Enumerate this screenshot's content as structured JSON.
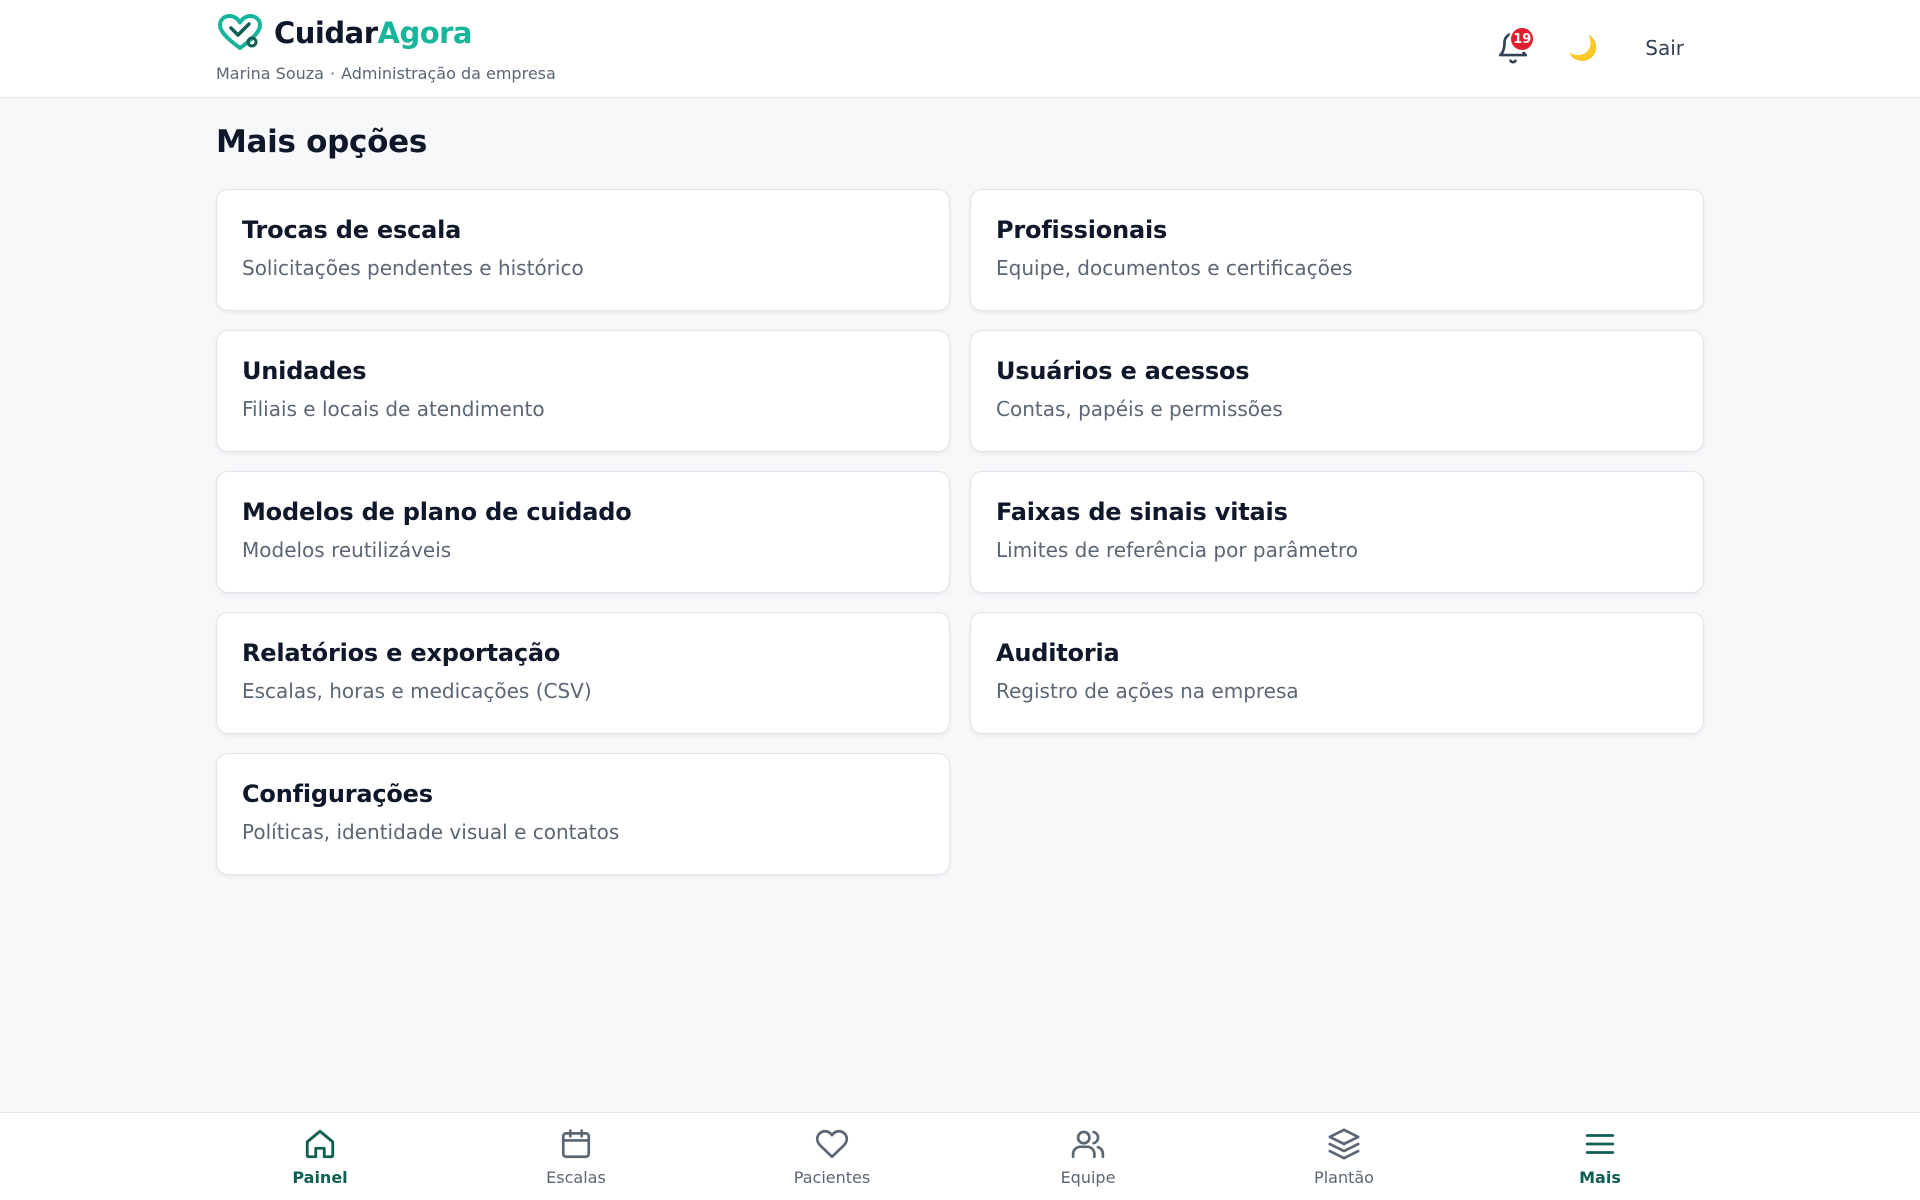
{
  "header": {
    "brand": {
      "name_part1": "Cuidar",
      "name_part2": "Agora"
    },
    "user_name": "Marina Souza",
    "separator": "·",
    "role": "Administração da empresa",
    "notifications": {
      "icon": "bell-icon",
      "count": "19"
    },
    "theme_toggle": {
      "icon": "moon-icon",
      "glyph": "🌙"
    },
    "logout_label": "Sair"
  },
  "main": {
    "title": "Mais opções",
    "cards": [
      {
        "title": "Trocas de escala",
        "description": "Solicitações pendentes e histórico"
      },
      {
        "title": "Profissionais",
        "description": "Equipe, documentos e certificações"
      },
      {
        "title": "Unidades",
        "description": "Filiais e locais de atendimento"
      },
      {
        "title": "Usuários e acessos",
        "description": "Contas, papéis e permissões"
      },
      {
        "title": "Modelos de plano de cuidado",
        "description": "Modelos reutilizáveis"
      },
      {
        "title": "Faixas de sinais vitais",
        "description": "Limites de referência por parâmetro"
      },
      {
        "title": "Relatórios e exportação",
        "description": "Escalas, horas e medicações (CSV)"
      },
      {
        "title": "Auditoria",
        "description": "Registro de ações na empresa"
      },
      {
        "title": "Configurações",
        "description": "Políticas, identidade visual e contatos"
      }
    ]
  },
  "bottom_nav": {
    "items": [
      {
        "label": "Painel",
        "icon": "home-icon",
        "active": true
      },
      {
        "label": "Escalas",
        "icon": "calendar-icon",
        "active": false
      },
      {
        "label": "Pacientes",
        "icon": "heart-icon",
        "active": false
      },
      {
        "label": "Equipe",
        "icon": "users-icon",
        "active": false
      },
      {
        "label": "Plantão",
        "icon": "layers-icon",
        "active": false
      },
      {
        "label": "Mais",
        "icon": "menu-icon",
        "active": true
      }
    ]
  },
  "colors": {
    "brand_accent": "#17b59a",
    "nav_active": "#0f5f54",
    "badge": "#e11d2e",
    "text_primary": "#0f172a",
    "text_muted": "#5b6675"
  }
}
